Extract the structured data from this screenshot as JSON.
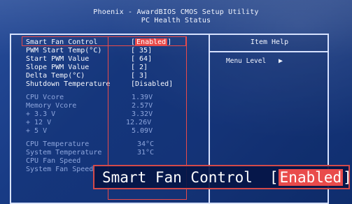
{
  "header": {
    "line1": "Phoenix - AwardBIOS CMOS Setup Utility",
    "line2": "PC Health Status"
  },
  "rows": [
    {
      "label": "Smart Fan Control",
      "value_open": "[",
      "value_text": "Enabled",
      "value_close": "]"
    },
    {
      "label": "PWM Start Temp(°C)",
      "value": "[ 35]"
    },
    {
      "label": "Start PWM Value",
      "value": "[ 64]"
    },
    {
      "label": "Slope PWM Value",
      "value": "[ 2]"
    },
    {
      "label": "Delta Temp(°C)",
      "value": "[ 3]"
    },
    {
      "label": "Shutdown Temperature",
      "value": "[Disabled]"
    },
    {
      "label": "CPU Vcore",
      "value": "1.39V"
    },
    {
      "label": "Memory Vcore",
      "value": "2.57V"
    },
    {
      "label": "+ 3.3 V",
      "value": "3.32V"
    },
    {
      "label": "+ 12  V",
      "value": "12.26V"
    },
    {
      "label": "+ 5   V",
      "value": "5.09V"
    },
    {
      "label": "CPU Temperature",
      "value": "34°C"
    },
    {
      "label": "System Temperature",
      "value": "31°C"
    },
    {
      "label": "CPU Fan Speed",
      "value": ""
    },
    {
      "label": "System Fan Speed",
      "value": ""
    }
  ],
  "help": {
    "title": "Item Help",
    "menu_level": "Menu Level",
    "menu_arrow": "▶"
  },
  "zoom": {
    "label": "Smart Fan Control",
    "value_open": "[",
    "value_text": "Enabled",
    "value_close": "]"
  },
  "colors": {
    "background": "#173880",
    "frame": "#d7e2ff",
    "highlight": "#e94b4b",
    "active_text": "#f7f9ff",
    "dim_text": "#8ea6dd"
  }
}
